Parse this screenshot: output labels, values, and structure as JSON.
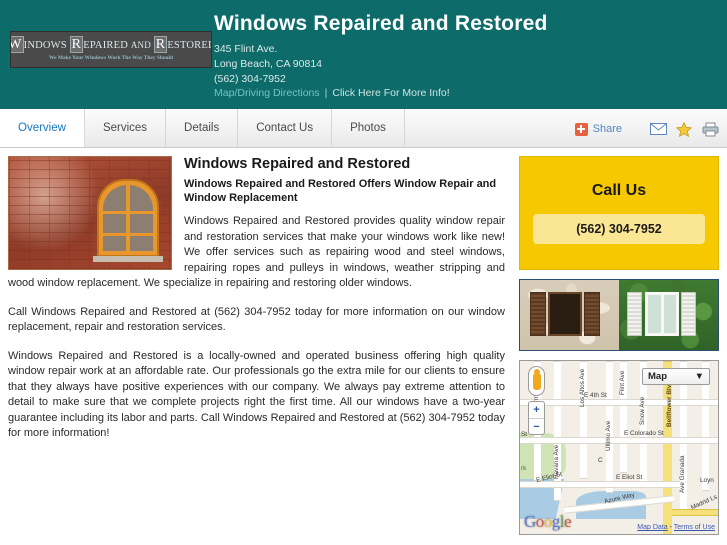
{
  "header": {
    "logo": {
      "words": [
        "Windows",
        "Repaired",
        "and",
        "Restored"
      ],
      "text": "WINDOWS REPAIRED AND RESTORED",
      "tagline": "We Make Your Windows Work The Way They Should"
    },
    "title": "Windows Repaired and Restored",
    "address_line1": "345 Flint Ave.",
    "address_line2": "Long Beach, CA 90814",
    "phone": "(562) 304-7952",
    "link_map": "Map",
    "link_slash": "/",
    "link_driving": "Driving Directions",
    "link_separator": "|",
    "link_more_info": "Click Here For More Info!"
  },
  "tabs": [
    {
      "label": "Overview",
      "active": true
    },
    {
      "label": "Services",
      "active": false
    },
    {
      "label": "Details",
      "active": false
    },
    {
      "label": "Contact Us",
      "active": false
    },
    {
      "label": "Photos",
      "active": false
    }
  ],
  "toolbar": {
    "share_label": "Share",
    "icons": [
      "share-plus-icon",
      "email-icon",
      "favorite-star-icon",
      "print-icon"
    ]
  },
  "main": {
    "title": "Windows Repaired and Restored",
    "subtitle": "Windows Repaired and Restored Offers Window Repair and Window Replacement",
    "paragraphs": [
      "Windows Repaired and Restored provides quality window repair and restoration services that make your windows work like new! We offer services such as repairing wood and steel windows, repairing ropes and pulleys in windows, weather stripping and wood window replacement. We specialize in repairing and restoring older windows.",
      "Call Windows Repaired and Restored at (562) 304-7952 today for more information on our window replacement, repair and restoration services.",
      "Windows Repaired and Restored is a locally-owned and operated business offering high quality window repair work at an affordable rate. Our professionals go the extra mile for our clients to ensure that they always have positive experiences with our company. We always pay extreme attention to detail to make sure that we complete projects right the first time. All our windows have a two-year guarantee including its labor and parts. Call Windows Repaired and Restored at (562) 304-7952 today for more information!"
    ],
    "hero_image_alt": "brick-wall-arched-window-photo"
  },
  "sidebar": {
    "call_title": "Call Us",
    "call_number": "(562) 304-7952",
    "photos": [
      "stone-wall-brown-shutters-window-photo",
      "ivy-covered-white-shutters-window-photo"
    ]
  },
  "map": {
    "type_label": "Map",
    "type_caret": "▼",
    "zoom_in": "+",
    "zoom_out": "−",
    "pegman": "street-view-pegman-icon",
    "brand": "Google",
    "footer_map_data": "Map Data",
    "footer_dash": " - ",
    "footer_terms": "Terms of Use",
    "labels": [
      "Termino Ave",
      "Havana Ave",
      "Los Altos Ave",
      "Flint Ave",
      "Snow Ave",
      "Bellflower Blvd",
      "E 4th St",
      "E Colorado St",
      "Ultimo Ave",
      "E Eliot St",
      "Azure Way",
      "Ave Granada",
      "Madrid Ls",
      "Loyn",
      "St",
      "C",
      "rk"
    ]
  },
  "colors": {
    "header_teal": "#0d6b69",
    "tab_active_text": "#1577c4",
    "call_box_yellow": "#f5c800",
    "call_num_yellow": "#fbe793",
    "share_orange": "#e8613c",
    "link_blue": "#4e87c7"
  }
}
